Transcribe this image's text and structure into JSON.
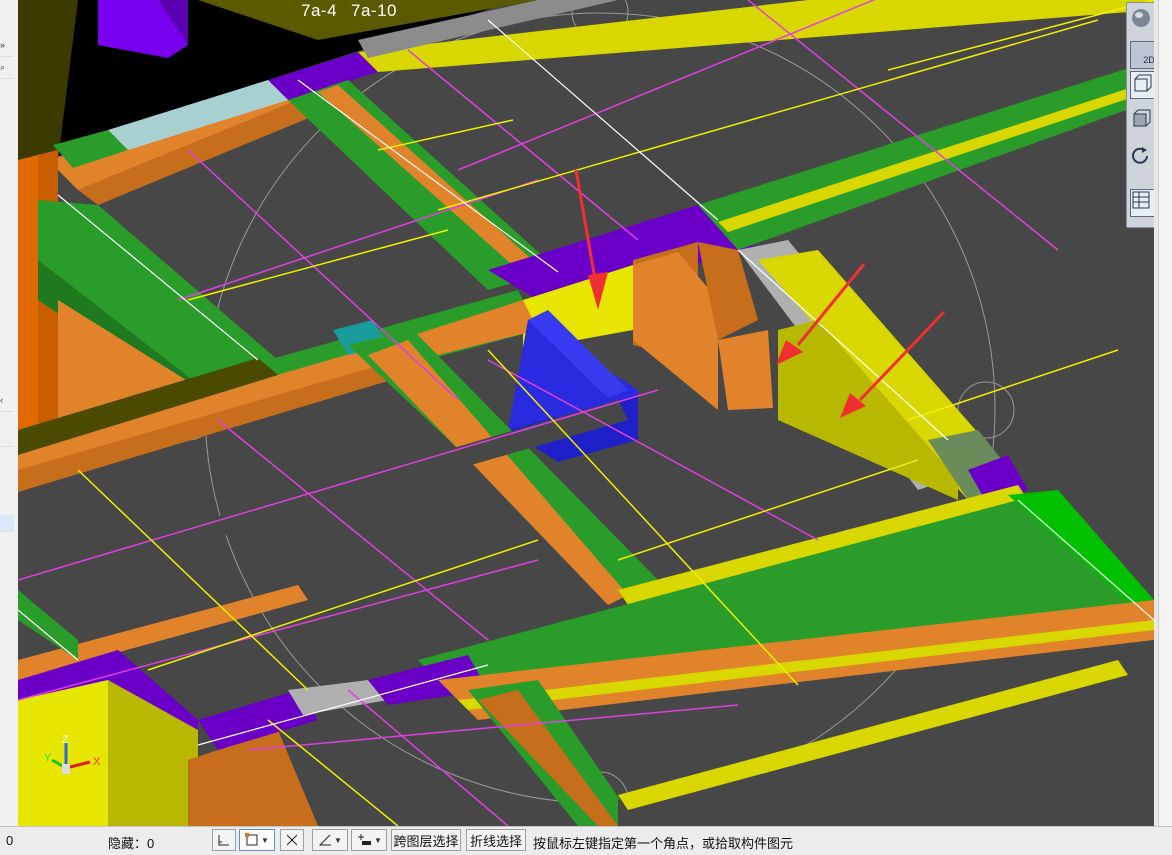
{
  "viewport": {
    "labels": [
      "7a-4",
      "7a-10"
    ],
    "axis": {
      "z": "Z",
      "y": "Y",
      "x": "X"
    }
  },
  "toolbox": {
    "items": [
      {
        "name": "orbit-sphere-icon"
      },
      {
        "name": "view-2d-icon",
        "label": "2D"
      },
      {
        "name": "view-3d-box-icon"
      },
      {
        "name": "view-dynamic-icon"
      },
      {
        "name": "rotate-icon"
      },
      {
        "name": "display-settings-icon"
      }
    ]
  },
  "statusbar": {
    "left_value": "0",
    "hidden_label": "隐藏：0",
    "cross_layer_label": "跨图层选择",
    "polyline_label": "折线选择",
    "prompt": "按鼠标左键指定第一个角点，或拾取构件图元"
  },
  "colors": {
    "background": "#474747",
    "beam_green": "#2a9c2a",
    "beam_orange": "#e0832b",
    "beam_yellow": "#d8d800",
    "beam_purple": "#6a00c8",
    "beam_blue": "#2a2ae0",
    "magenta_line": "#e040e0",
    "yellow_line": "#f0f000",
    "arrow_red": "#f03030"
  }
}
